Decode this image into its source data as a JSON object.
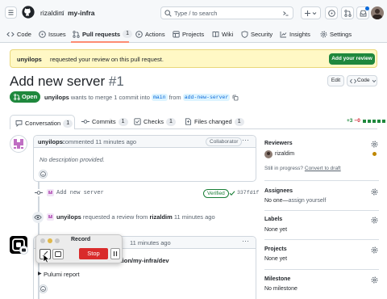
{
  "header": {
    "owner": "rizaldim",
    "separator": "/",
    "repo": "my-infra",
    "search_placeholder": "Type / to search"
  },
  "repo_nav": {
    "items": [
      {
        "label": "Code",
        "icon": "code-icon"
      },
      {
        "label": "Issues",
        "icon": "issue-icon"
      },
      {
        "label": "Pull requests",
        "count": "1",
        "icon": "pull-request-icon"
      },
      {
        "label": "Actions",
        "icon": "play-icon"
      },
      {
        "label": "Projects",
        "icon": "table-icon"
      },
      {
        "label": "Wiki",
        "icon": "book-icon"
      },
      {
        "label": "Security",
        "icon": "shield-icon"
      },
      {
        "label": "Insights",
        "icon": "graph-icon"
      },
      {
        "label": "Settings",
        "icon": "gear-icon"
      }
    ]
  },
  "banner": {
    "user": "unyilops",
    "text": " requested your review on this pull request.",
    "button": "Add your review"
  },
  "pr": {
    "title": "Add new server",
    "number": "#1",
    "edit": "Edit",
    "code": "Code",
    "status": "Open",
    "author": "unyilops",
    "merge_text": " wants to merge 1 commit into ",
    "base": "main",
    "from": " from ",
    "head": "add-new-server"
  },
  "tabs": [
    {
      "label": "Conversation",
      "count": "1"
    },
    {
      "label": "Commits",
      "count": "1"
    },
    {
      "label": "Checks",
      "count": "1"
    },
    {
      "label": "Files changed",
      "count": "1"
    }
  ],
  "diffstat": {
    "add": "+3",
    "del": "−0"
  },
  "comment": {
    "author": "unyilops",
    "meta": " commented 11 minutes ago",
    "badge": "Collaborator",
    "body": "No description provided."
  },
  "commit": {
    "message": "Add new server",
    "status": "Verified",
    "sha": "337fd1f"
  },
  "review_event": {
    "actor": "unyilops",
    "text": " requested a review from ",
    "reviewer": "rizaldim",
    "time": " 11 minutes ago"
  },
  "bot_comment": {
    "time": "11 minutes ago",
    "stack": "ation/my-infra/dev",
    "details": "Pulumi report"
  },
  "recorder": {
    "title": "Record",
    "stop": "Stop"
  },
  "sidebar": {
    "reviewers": {
      "heading": "Reviewers",
      "name": "rizaldim",
      "wip": "Still in progress?",
      "convert": "Convert to draft"
    },
    "assignees": {
      "heading": "Assignees",
      "value": "No one—",
      "link": "assign yourself"
    },
    "labels": {
      "heading": "Labels",
      "value": "None yet"
    },
    "projects": {
      "heading": "Projects",
      "value": "None yet"
    },
    "milestone": {
      "heading": "Milestone",
      "value": "No milestone"
    }
  },
  "colors": {
    "accent": "#0969da",
    "green": "#1f883d",
    "red": "#cf222e",
    "banner": "#fff8c5"
  }
}
